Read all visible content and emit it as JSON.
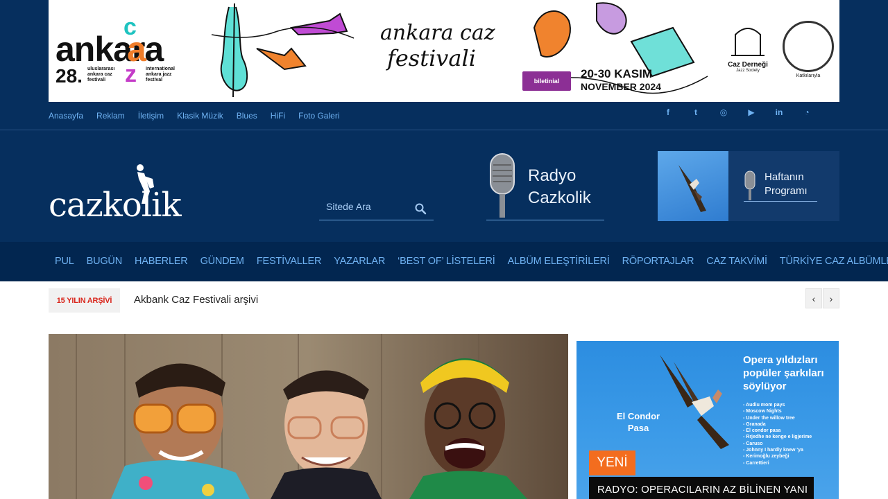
{
  "banner": {
    "logo_word": "ankara",
    "logo_caz": [
      "c",
      "a",
      "z"
    ],
    "edition": "28.",
    "small_tr": [
      "uluslararası",
      "ankara caz",
      "festivali"
    ],
    "small_en": [
      "international",
      "ankara jazz",
      "festival"
    ],
    "script_title": [
      "ankara caz",
      "festivali"
    ],
    "ticket_label": "biletinial",
    "dates": [
      "20-30 KASIM",
      "NOVEMBER 2024"
    ],
    "society_name": "Caz Derneği",
    "society_en": "Jazz Society",
    "support_label": "Katkılarıyla"
  },
  "topnav": {
    "links": [
      "Anasayfa",
      "Reklam",
      "İletişim",
      "Klasik Müzik",
      "Blues",
      "HiFi",
      "Foto Galeri"
    ]
  },
  "social": {
    "icons": [
      "facebook-icon",
      "twitter-icon",
      "instagram-icon",
      "youtube-icon",
      "linkedin-icon",
      "rss-icon"
    ],
    "glyphs": [
      "f",
      "t",
      "◎",
      "▶",
      "in",
      "◔"
    ]
  },
  "header": {
    "logo_text": "cazkolik",
    "search_placeholder": "Sitede Ara",
    "radio_title_1": "Radyo",
    "radio_title_2": "Cazkolik",
    "program_line_1": "Haftanın",
    "program_line_2": "Programı"
  },
  "mainnav": {
    "items": [
      "PUL",
      "BUGÜN",
      "HABERLER",
      "GÜNDEM",
      "FESTİVALLER",
      "YAZARLAR",
      "‘BEST OF’ LİSTELERİ",
      "ALBÜM ELEŞTİRİLERİ",
      "RÖPORTAJLAR",
      "CAZ TAKVİMİ",
      "TÜRKİYE CAZ ALBÜMLERİ"
    ]
  },
  "ticker": {
    "label": "15 YILIN ARŞİVİ",
    "text": "Akbank Caz Festivali arşivi",
    "prev": "‹",
    "next": "›"
  },
  "ad": {
    "title": [
      "Opera yıldızları",
      "popüler şarkıları",
      "söylüyor"
    ],
    "songs": [
      "- Audiu mom pays",
      "- Moscow Nights",
      "- Under the willow tree",
      "- Granada",
      "- El condor pasa",
      "- Rrjedhe ne kenge e ligjerime",
      "- Caruso",
      "- Johnny I hardly knew 'ya",
      "- Kerimoğlu zeybeği",
      "- Carrettieri"
    ],
    "condor": [
      "El Condor",
      "Pasa"
    ],
    "new_badge": "YENİ",
    "headline": "RADYO: OPERACILARIN AZ BİLİNEN YANI"
  },
  "colors": {
    "page_bg": "#062f5e",
    "nav_bg": "#022650",
    "link": "#6fb2f2",
    "ticker_label": "#d9261c",
    "ad_badge": "#f36d1f"
  }
}
